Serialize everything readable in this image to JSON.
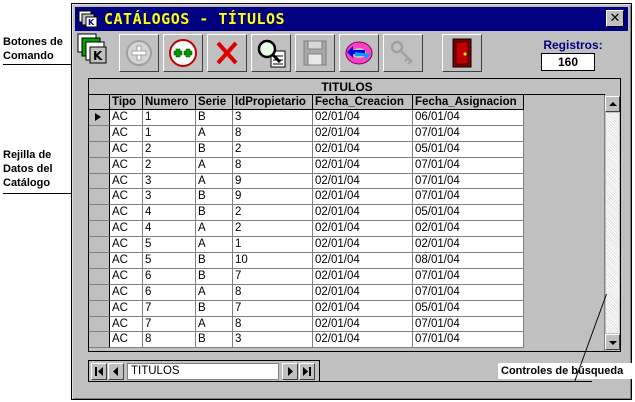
{
  "window": {
    "title": "CATÁLOGOS - TÍTULOS",
    "close_glyph": "✕"
  },
  "annotations": {
    "command_buttons": [
      "Botones de",
      "Comando"
    ],
    "data_grid": [
      "Rejilla de",
      "Datos del",
      "Catálogo"
    ],
    "search_controls": "Controles de búsqueda"
  },
  "toolbar": {
    "buttons": [
      {
        "name": "add-button",
        "icon": "plus-circle-icon",
        "enabled": false
      },
      {
        "name": "add-multiple-button",
        "icon": "double-plus-icon",
        "enabled": true
      },
      {
        "name": "delete-button",
        "icon": "red-x-icon",
        "enabled": true
      },
      {
        "name": "search-button",
        "icon": "magnifier-icon",
        "enabled": true
      },
      {
        "name": "save-button",
        "icon": "floppy-disk-icon",
        "enabled": false
      },
      {
        "name": "refresh-button",
        "icon": "refresh-arrows-icon",
        "enabled": true
      },
      {
        "name": "keys-button",
        "icon": "keys-icon",
        "enabled": false
      },
      {
        "name": "exit-button",
        "icon": "exit-door-icon",
        "enabled": true
      }
    ]
  },
  "records": {
    "label": "Registros:",
    "count": "160"
  },
  "grid": {
    "caption": "TITULOS",
    "columns": [
      "Tipo",
      "Numero",
      "Serie",
      "IdPropietario",
      "Fecha_Creacion",
      "Fecha_Asignacion"
    ],
    "rows": [
      [
        "AC",
        "1",
        "B",
        "3",
        "02/01/04",
        "06/01/04"
      ],
      [
        "AC",
        "1",
        "A",
        "8",
        "02/01/04",
        "07/01/04"
      ],
      [
        "AC",
        "2",
        "B",
        "2",
        "02/01/04",
        "05/01/04"
      ],
      [
        "AC",
        "2",
        "A",
        "8",
        "02/01/04",
        "07/01/04"
      ],
      [
        "AC",
        "3",
        "A",
        "9",
        "02/01/04",
        "07/01/04"
      ],
      [
        "AC",
        "3",
        "B",
        "9",
        "02/01/04",
        "07/01/04"
      ],
      [
        "AC",
        "4",
        "B",
        "2",
        "02/01/04",
        "05/01/04"
      ],
      [
        "AC",
        "4",
        "A",
        "2",
        "02/01/04",
        "02/01/04"
      ],
      [
        "AC",
        "5",
        "A",
        "1",
        "02/01/04",
        "02/01/04"
      ],
      [
        "AC",
        "5",
        "B",
        "10",
        "02/01/04",
        "08/01/04"
      ],
      [
        "AC",
        "6",
        "B",
        "7",
        "02/01/04",
        "07/01/04"
      ],
      [
        "AC",
        "6",
        "A",
        "8",
        "02/01/04",
        "07/01/04"
      ],
      [
        "AC",
        "7",
        "B",
        "7",
        "02/01/04",
        "05/01/04"
      ],
      [
        "AC",
        "7",
        "A",
        "8",
        "02/01/04",
        "07/01/04"
      ],
      [
        "AC",
        "8",
        "B",
        "3",
        "02/01/04",
        "07/01/04"
      ]
    ],
    "current_row": 0
  },
  "navigator": {
    "caption": "TITULOS"
  },
  "colors": {
    "titlebar": "#000080",
    "title_text": "#ffff00",
    "records_label": "#000080"
  }
}
